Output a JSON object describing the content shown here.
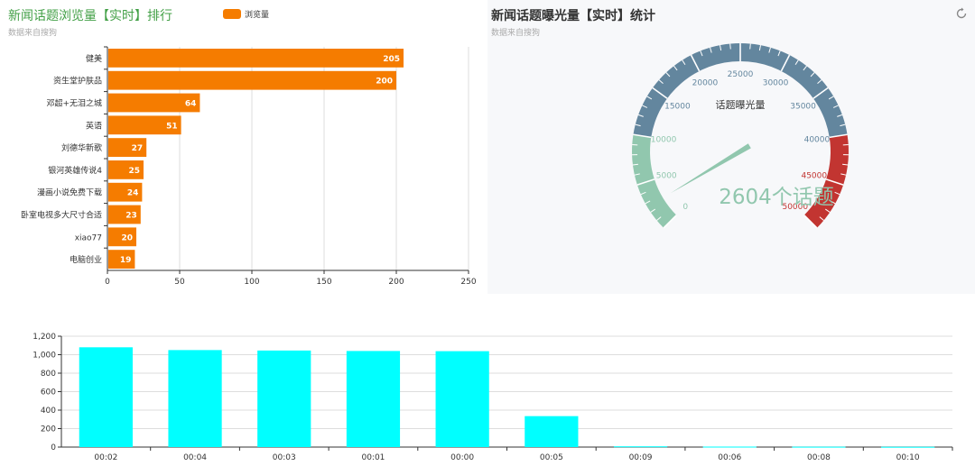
{
  "bar_panel": {
    "title": "新闻话题浏览量【实时】排行",
    "subtitle": "数据来自搜狗",
    "legend_label": "浏览量",
    "bar_color": "#f57c00",
    "title_color": "#43a047"
  },
  "gauge_panel": {
    "title": "新闻话题曝光量【实时】统计",
    "subtitle": "数据来自搜狗",
    "title_color": "#333333",
    "refresh_icon": "refresh-icon"
  },
  "chart_data": [
    {
      "type": "bar",
      "orientation": "horizontal",
      "title": "新闻话题浏览量【实时】排行",
      "subtitle": "数据来自搜狗",
      "categories": [
        "电脑创业",
        "xiao77",
        "卧室电视多大尺寸合适",
        "漫画小说免费下载",
        "银河英雄传说4",
        "刘德华新歌",
        "英语",
        "邓超+无泪之城",
        "资生堂护肤品",
        "健美"
      ],
      "series": [
        {
          "name": "浏览量",
          "values": [
            19,
            20,
            23,
            24,
            25,
            27,
            51,
            64,
            200,
            205
          ]
        }
      ],
      "xlim": [
        0,
        250
      ],
      "xticks": [
        0,
        50,
        100,
        150,
        200,
        250
      ],
      "grid": true,
      "legend": "top-center"
    },
    {
      "type": "gauge",
      "title": "新闻话题曝光量【实时】统计",
      "subtitle": "数据来自搜狗",
      "label": "话题曝光量",
      "value": 2604,
      "display_text": "2604个话题",
      "min": 0,
      "max": 50000,
      "tick_labels": [
        "0",
        "5000",
        "10000",
        "15000",
        "20000",
        "25000",
        "30000",
        "35000",
        "40000",
        "45000",
        "50000"
      ],
      "bands": [
        {
          "from": 0,
          "to": 10000,
          "color": "#91c7ae"
        },
        {
          "from": 10000,
          "to": 40000,
          "color": "#63869e"
        },
        {
          "from": 40000,
          "to": 50000,
          "color": "#c23531"
        }
      ]
    },
    {
      "type": "bar",
      "categories": [
        "00:02",
        "00:04",
        "00:03",
        "00:01",
        "00:00",
        "00:05",
        "00:09",
        "00:06",
        "00:08",
        "00:10"
      ],
      "values": [
        1080,
        1050,
        1045,
        1040,
        1038,
        335,
        8,
        5,
        4,
        3
      ],
      "ylim": [
        0,
        1200
      ],
      "yticks": [
        "0",
        "200",
        "400",
        "600",
        "800",
        "1,000",
        "1,200"
      ],
      "grid": true,
      "bar_color": "#00ffff"
    }
  ]
}
